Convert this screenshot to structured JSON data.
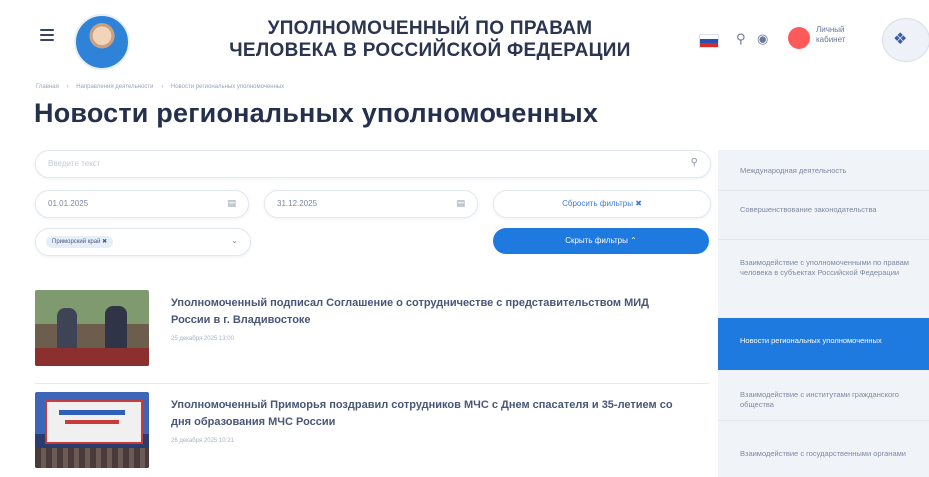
{
  "header": {
    "title_line1": "УПОЛНОМОЧЕННЫЙ ПО ПРАВАМ",
    "title_line2": "ЧЕЛОВЕКА В РОССИЙСКОЙ ФЕДЕРАЦИИ",
    "account_label": "Личный кабинет",
    "icons": [
      "menu-icon",
      "search-icon",
      "accessibility-eye-icon",
      "account-icon",
      "emblem-icon"
    ]
  },
  "breadcrumbs": [
    "Главная",
    "Направления деятельности",
    "Новости региональных уполномоченных"
  ],
  "page_title": "Новости региональных уполномоченных",
  "filters": {
    "search_placeholder": "Введите текст",
    "date_from": "01.01.2025",
    "date_to": "31.12.2025",
    "reset_label": "Сбросить фильтры ✖",
    "region_chip": "Приморский край ✖",
    "hide_label": "Скрыть фильтры ⌃"
  },
  "news": [
    {
      "title": "Уполномоченный подписал Соглашение о сотрудничестве с представительством МИД России в г. Владивостоке",
      "date": "25 декабря 2025 13:00"
    },
    {
      "title": "Уполномоченный Приморья поздравил сотрудников МЧС с Днем спасателя и 35-летием со дня образования МЧС России",
      "date": "26 декабря 2025 10:21"
    }
  ],
  "sidebar": [
    {
      "label": "Международная деятельность",
      "active": false
    },
    {
      "label": "Совершенствование законодательства",
      "active": false
    },
    {
      "label": "Взаимодействие с уполномоченными по правам человека в субъектах Российской Федерации",
      "active": false
    },
    {
      "label": "Новости региональных уполномоченных",
      "active": true
    },
    {
      "label": "Взаимодействие с институтами гражданского общества",
      "active": false
    },
    {
      "label": "Взаимодействие с государственными органами",
      "active": false
    }
  ],
  "colors": {
    "accent": "#1f7ae0",
    "title_text": "#25304d",
    "account_dot": "#ff5a5a"
  }
}
